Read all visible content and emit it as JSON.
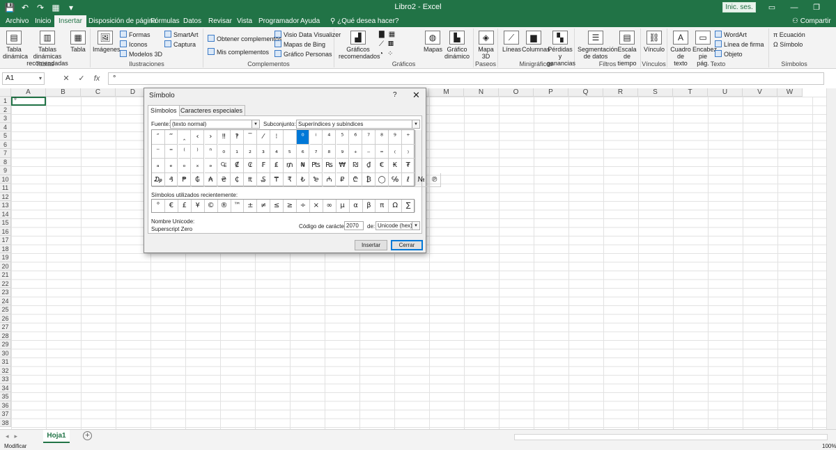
{
  "window": {
    "title": "Libro2  -  Excel",
    "signin": "Inic. ses.",
    "share": "Compartir"
  },
  "tabs": [
    {
      "label": "Archivo"
    },
    {
      "label": "Inicio"
    },
    {
      "label": "Insertar"
    },
    {
      "label": "Disposición de página"
    },
    {
      "label": "Fórmulas"
    },
    {
      "label": "Datos"
    },
    {
      "label": "Revisar"
    },
    {
      "label": "Vista"
    },
    {
      "label": "Programador"
    },
    {
      "label": "Ayuda"
    },
    {
      "label": "¿Qué desea hacer?"
    }
  ],
  "ribbon": {
    "tablas": {
      "label": "Tablas",
      "dinamica": "Tabla dinámica",
      "recomendadas": "Tablas dinámicas recomendadas",
      "tabla": "Tabla"
    },
    "ilustraciones": {
      "label": "Ilustraciones",
      "imagenes": "Imágenes",
      "formas": "Formas",
      "iconos": "Iconos",
      "modelos": "Modelos 3D",
      "smartart": "SmartArt",
      "captura": "Captura"
    },
    "complementos": {
      "label": "Complementos",
      "obtener": "Obtener complementos",
      "mis": "Mis complementos",
      "visio": "Visio Data Visualizer",
      "bing": "Mapas de Bing",
      "personas": "Gráfico Personas"
    },
    "graficos": {
      "label": "Gráficos",
      "recomendados": "Gráficos recomendados",
      "mapas": "Mapas",
      "dinamico": "Gráfico dinámico"
    },
    "paseos": {
      "label": "Paseos",
      "mapa3d": "Mapa 3D"
    },
    "minigraficos": {
      "label": "Minigráficos",
      "lineas": "Líneas",
      "columnas": "Columnas",
      "perdidas": "Pérdidas y ganancias"
    },
    "filtros": {
      "label": "Filtros",
      "segmentacion": "Segmentación de datos",
      "escala": "Escala de tiempo"
    },
    "vinculos": {
      "label": "Vínculos",
      "vinculo": "Vínculo"
    },
    "texto": {
      "label": "Texto",
      "cuadro": "Cuadro de texto",
      "encabez": "Encabez. pie pág.",
      "wordart": "WordArt",
      "firma": "Línea de firma",
      "objeto": "Objeto"
    },
    "simbolos": {
      "label": "Símbolos",
      "ecuacion": "Ecuación",
      "simbolo": "Símbolo"
    }
  },
  "formula_bar": {
    "namebox": "A1",
    "value": "°",
    "fx": "fx"
  },
  "grid": {
    "columns": [
      "A",
      "B",
      "C",
      "D",
      "E",
      "F",
      "G",
      "H",
      "I",
      "J",
      "K",
      "L",
      "M",
      "N",
      "O",
      "P",
      "Q",
      "R",
      "S",
      "T",
      "U",
      "V",
      "W"
    ],
    "rows": [
      "1",
      "2",
      "3",
      "4",
      "5",
      "6",
      "7",
      "8",
      "9",
      "10",
      "11",
      "12",
      "13",
      "14",
      "15",
      "16",
      "17",
      "18",
      "19",
      "20",
      "21",
      "22",
      "23",
      "24",
      "25",
      "26",
      "27",
      "28",
      "29",
      "30",
      "31",
      "32",
      "33",
      "34",
      "35",
      "36",
      "37",
      "38"
    ],
    "active_value": "°"
  },
  "sheet": {
    "tab": "Hoja1",
    "add": "+"
  },
  "status": {
    "mode": "Modificar",
    "zoom": "100%"
  },
  "dialog": {
    "title": "Símbolo",
    "help": "?",
    "close": "✕",
    "tabs": [
      "Símbolos",
      "Caracteres especiales"
    ],
    "font_label": "Fuente:",
    "font_value": "(texto normal)",
    "subset_label": "Subconjunto:",
    "subset_value": "Superíndices y subíndices",
    "symbols": [
      [
        "″",
        "‴",
        "‸",
        "‹",
        "›",
        "‼",
        "‽",
        "‾",
        "⁄",
        "⁝",
        "",
        "⁰",
        "ⁱ",
        "⁴",
        "⁵",
        "⁶",
        "⁷",
        "⁸",
        "⁹",
        "⁺"
      ],
      [
        "⁻",
        "⁼",
        "⁽",
        "⁾",
        "ⁿ",
        "₀",
        "₁",
        "₂",
        "₃",
        "₄",
        "₅",
        "₆",
        "₇",
        "₈",
        "₉",
        "₊",
        "₋",
        "₌",
        "₍",
        "₎"
      ],
      [
        "ₐ",
        "ₑ",
        "ₒ",
        "ₓ",
        "ₔ",
        "₠",
        "₡",
        "₢",
        "₣",
        "₤",
        "₥",
        "₦",
        "₧",
        "₨",
        "₩",
        "₪",
        "₫",
        "€",
        "₭",
        "₮"
      ],
      [
        "₯",
        "₰",
        "₱",
        "₲",
        "₳",
        "₴",
        "₵",
        "₶",
        "₷",
        "₸",
        "₹",
        "₺",
        "₻",
        "₼",
        "₽",
        "₾",
        "₿",
        "◯",
        "℅",
        "ℓ",
        "№",
        "℗"
      ]
    ],
    "recent_label": "Símbolos utilizados recientemente:",
    "recent": [
      "°",
      "€",
      "£",
      "¥",
      "©",
      "®",
      "™",
      "±",
      "≠",
      "≤",
      "≥",
      "÷",
      "×",
      "∞",
      "µ",
      "α",
      "β",
      "π",
      "Ω",
      "∑"
    ],
    "unicode_name_label": "Nombre Unicode:",
    "unicode_name": "Superscript Zero",
    "code_label": "Código de carácter:",
    "code_value": "2070",
    "from_label": "de:",
    "from_value": "Unicode (hex)",
    "insert": "Insertar",
    "cancel": "Cerrar"
  },
  "colors": {
    "excel_green": "#217346",
    "selection_blue": "#0078d7"
  }
}
